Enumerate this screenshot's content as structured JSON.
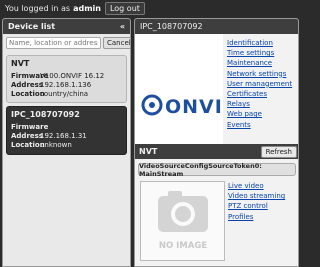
{
  "topbar": {
    "logged_in_text": "You logged in as",
    "username": "admin",
    "logout_label": "Log out"
  },
  "device_list": {
    "title": "Device list",
    "collapse_glyph": "«",
    "search_placeholder": "Name, location or address",
    "clear_label": "Cancel",
    "labels": {
      "firmware": "Firmware",
      "address": "Address",
      "location": "Location"
    },
    "devices": [
      {
        "name": "NVT",
        "firmware": "V100.ONVIF 16.12",
        "address": "192.168.1.136",
        "location": "country/china",
        "selected": false
      },
      {
        "name": "IPC_108707092",
        "firmware": "",
        "address": "192.168.1.31",
        "location": "unknown",
        "selected": true
      }
    ]
  },
  "device_panel": {
    "title": "IPC_108707092",
    "logo_text": "ONVIF",
    "links": [
      "Identification",
      "Time settings",
      "Maintenance",
      "Network settings",
      "User management",
      "Certificates",
      "Relays",
      "Web page",
      "Events"
    ]
  },
  "nvt_section": {
    "title": "NVT",
    "refresh_label": "Refresh",
    "profile_title": "VideoSourceConfigSourceToken0: MainStream",
    "noimage_text": "NO IMAGE",
    "links": [
      "Live video",
      "Video streaming",
      "PTZ control",
      "Profiles"
    ]
  },
  "colors": {
    "dark_bar": "#3e3e3e",
    "link": "#0645ad",
    "onvif_blue": "#1e4f9c"
  },
  "icons": {
    "collapse": "double-chevron-left-icon",
    "noimage": "camera-placeholder-icon"
  }
}
